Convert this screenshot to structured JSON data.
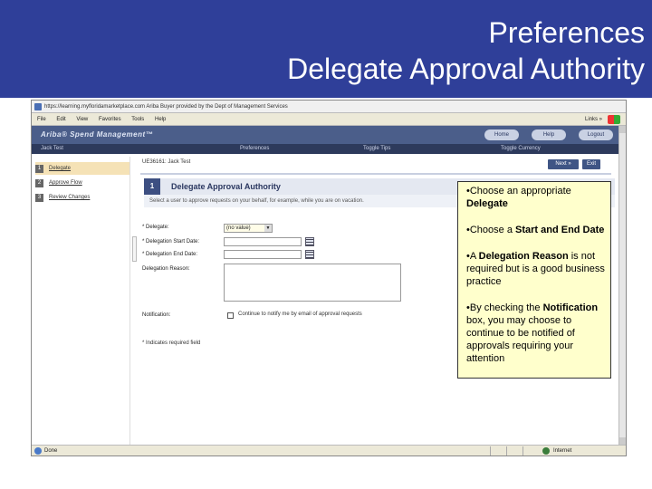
{
  "slide": {
    "title_line1": "Preferences",
    "title_line2": "Delegate Approval Authority",
    "title_band_color": "#2f3f99"
  },
  "browser": {
    "address": "https://learning.myfloridamarketplace.com  Ariba Buyer  provided by the Dept of Management Services",
    "menu": [
      "File",
      "Edit",
      "View",
      "Favorites",
      "Tools",
      "Help"
    ],
    "menu_links": "Links »",
    "status_text": "Done",
    "zone_text": "Internet"
  },
  "app": {
    "brand": "Ariba® Spend Management™",
    "top_buttons": [
      "Home",
      "Help",
      "Logout"
    ],
    "nav_items": [
      "Jack Test",
      "Preferences",
      "Toggle Tips",
      "Toggle Currency"
    ],
    "sidebar_steps": [
      {
        "num": "1",
        "label": "Delegate",
        "active": true
      },
      {
        "num": "2",
        "label": "Approve Flow",
        "active": false
      },
      {
        "num": "3",
        "label": "Review Changes",
        "active": false
      }
    ],
    "record_label": "UE36161: Jack Test",
    "next_button": "Next »",
    "exit_button": "Exit",
    "section_number": "1",
    "section_title": "Delegate Approval Authority",
    "instruction": "Select a user to approve requests on your behalf, for example, while you are on vacation.",
    "form": {
      "delegate_label": "* Delegate:",
      "delegate_value": "(no value)",
      "start_label": "* Delegation Start Date:",
      "end_label": "* Delegation End Date:",
      "reason_label": "Delegation Reason:",
      "notification_label": "Notification:",
      "notification_text": "Continue to notify me by email of approval requests"
    },
    "required_note": "* Indicates required field"
  },
  "callout": {
    "p1_plain": "•Choose an appropriate ",
    "p1_bold": "Delegate",
    "p2_plain": "•Choose a ",
    "p2_bold": "Start and End Date",
    "p3_plain1": "•A ",
    "p3_bold": "Delegation Reason",
    "p3_plain2": " is not required but is a good business practice",
    "p4_plain1": "•By checking the ",
    "p4_bold": "Notification",
    "p4_plain2": " box, you may choose to continue to be notified of approvals requiring your attention",
    "background": "#ffffcc"
  }
}
